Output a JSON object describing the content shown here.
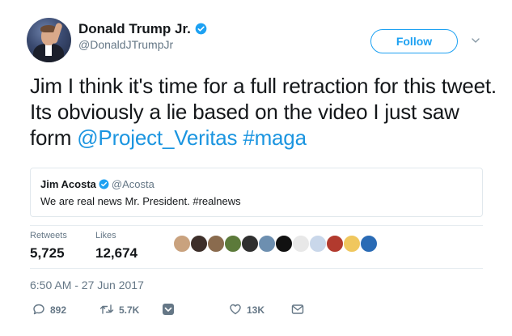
{
  "author": {
    "display_name": "Donald Trump Jr.",
    "handle": "@DonaldJTrumpJr",
    "verified": true
  },
  "follow_label": "Follow",
  "tweet": {
    "text_plain": "Jim I think it's time for a full retraction for this tweet. Its obviously a lie based on the video I just saw form ",
    "mention": "@Project_Veritas",
    "space": " ",
    "hashtag": "#maga"
  },
  "quoted_tweet": {
    "display_name": "Jim Acosta",
    "handle": "@Acosta",
    "text": "We are real news Mr. President. #realnews"
  },
  "stats": {
    "retweets_label": "Retweets",
    "retweets_value": "5,725",
    "likes_label": "Likes",
    "likes_value": "12,674"
  },
  "likers": [
    "#c9a27e",
    "#3d2f2a",
    "#8a6b4e",
    "#5c7a3a",
    "#2f2f2f",
    "#6d8fb0",
    "#111111",
    "#e8e8e8",
    "#c9d7ea",
    "#b23a2e",
    "#f0c75e",
    "#2a6bb5"
  ],
  "timestamp": "6:50 AM - 27 Jun 2017",
  "actions": {
    "replies": "892",
    "retweets": "5.7K",
    "likes": "13K"
  },
  "colors": {
    "accent": "#1da1f2",
    "link": "#1b95e0",
    "muted": "#657786"
  }
}
